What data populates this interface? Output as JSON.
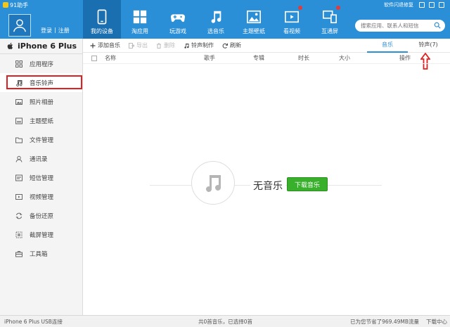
{
  "app": {
    "title": "91助手"
  },
  "header": {
    "login": "登录",
    "sep": "|",
    "register": "注册",
    "sys_tools": "软件闪退修复",
    "search_placeholder": "搜索应用、联系人和短信"
  },
  "nav": [
    {
      "label": "我的设备",
      "icon": "phone-icon",
      "active": true
    },
    {
      "label": "淘应用",
      "icon": "apps-grid-icon"
    },
    {
      "label": "玩游戏",
      "icon": "gamepad-icon"
    },
    {
      "label": "选音乐",
      "icon": "music-note-icon"
    },
    {
      "label": "主题壁纸",
      "icon": "image-icon"
    },
    {
      "label": "看视频",
      "icon": "film-icon",
      "badge": true
    },
    {
      "label": "互通屏",
      "icon": "screens-icon",
      "badge": true
    }
  ],
  "sidebar": {
    "device": "iPhone 6 Plus",
    "items": [
      {
        "label": "应用程序",
        "icon": "grid-icon"
      },
      {
        "label": "音乐铃声",
        "icon": "music-icon",
        "active": true
      },
      {
        "label": "照片相册",
        "icon": "photo-icon"
      },
      {
        "label": "主题壁纸",
        "icon": "wallpaper-icon"
      },
      {
        "label": "文件管理",
        "icon": "folder-icon"
      },
      {
        "label": "通讯录",
        "icon": "contact-icon"
      },
      {
        "label": "短信管理",
        "icon": "sms-icon"
      },
      {
        "label": "视频管理",
        "icon": "video-icon"
      },
      {
        "label": "备份还原",
        "icon": "backup-icon"
      },
      {
        "label": "截屏管理",
        "icon": "screenshot-icon"
      },
      {
        "label": "工具箱",
        "icon": "toolbox-icon"
      }
    ]
  },
  "toolbar": {
    "add_music": "添加音乐",
    "export": "导出",
    "delete": "删除",
    "ringtone_make": "铃声制作",
    "refresh": "刷新"
  },
  "tabs": {
    "music": "音乐",
    "ringtone": "铃声(7)"
  },
  "columns": {
    "name": "名称",
    "artist": "歌手",
    "album": "专辑",
    "duration": "时长",
    "size": "大小",
    "action": "操作"
  },
  "empty": {
    "text": "无音乐",
    "download_button": "下载音乐"
  },
  "status": {
    "device": "iPhone 6 Plus  USB连接",
    "summary": "共0首音乐，已选择0首",
    "saved": "已为您节省了969.49MB流量",
    "download_center": "下载中心"
  },
  "colors": {
    "header": "#2a8fd6",
    "active_nav": "#1a6fb0",
    "download_btn": "#38b02c",
    "highlight": "#e02020"
  }
}
